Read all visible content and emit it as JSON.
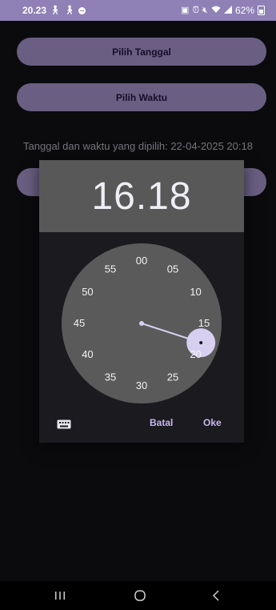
{
  "status_bar": {
    "time": "20.23",
    "battery_percent": "62%",
    "left_icons": [
      "walk-icon",
      "walk-icon",
      "do-not-disturb-icon"
    ],
    "right_icons": [
      "sim-icon",
      "alarm-icon",
      "mute-icon",
      "wifi-icon",
      "signal-icon",
      "battery-icon"
    ]
  },
  "app": {
    "date_button_label": "Pilih Tanggal",
    "time_button_label": "Pilih Waktu",
    "selected_text": "Tanggal dan waktu yang dipilih: 22-04-2025 20:18"
  },
  "time_picker": {
    "display_time": "16.18",
    "selected_minute": 18,
    "dial_labels": [
      "00",
      "05",
      "10",
      "15",
      "20",
      "25",
      "30",
      "35",
      "40",
      "45",
      "50",
      "55"
    ],
    "cancel_label": "Batal",
    "ok_label": "Oke",
    "keyboard_toggle_icon": "keyboard-icon"
  },
  "nav_bar": {
    "items": [
      "recents-icon",
      "home-icon",
      "back-icon"
    ]
  },
  "colors": {
    "status_bar": "#8f81b6",
    "button": "#a392c8",
    "dialog_header": "#585858",
    "dial": "#5a5a5a",
    "selector": "#d7cff0",
    "hand": "#d7cff0",
    "accent_text": "#c8b9ee"
  }
}
